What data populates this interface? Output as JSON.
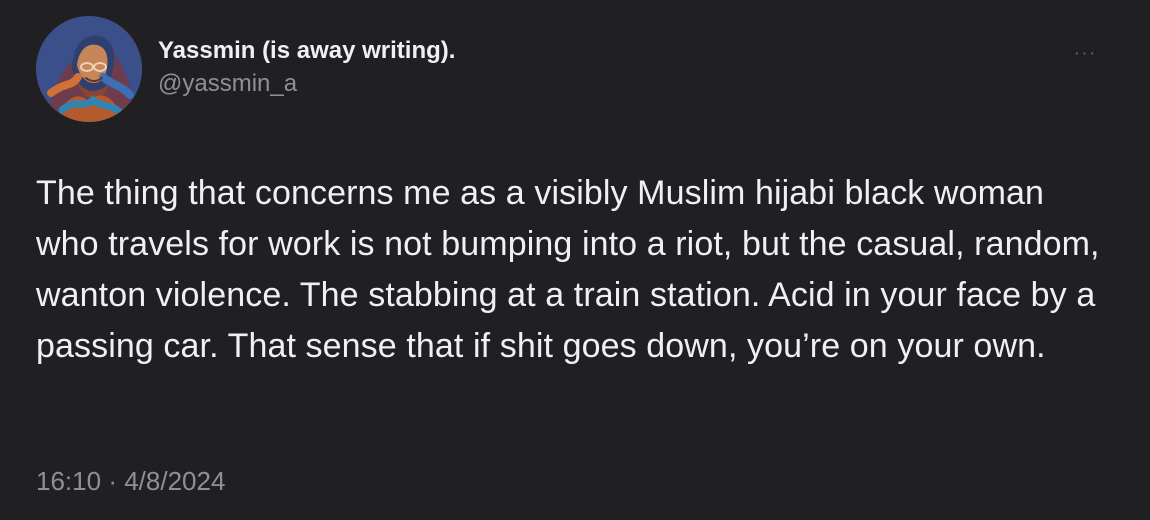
{
  "tweet": {
    "display_name": "Yassmin (is away writing).",
    "handle": "@yassmin_a",
    "text": "The thing that concerns me as a visibly Muslim hijabi black woman who travels for work is not bumping into a riot, but the casual, random,  wanton violence. The stabbing at a train station. Acid in your face by a passing car. That sense that if shit goes down, you’re on your own.",
    "time": "16:10",
    "separator": "·",
    "date": "4/8/2024"
  },
  "icons": {
    "avatar": "avatar-image",
    "more": "more-options-icon"
  },
  "colors": {
    "background": "#202023",
    "primary_text": "#eef0f2",
    "secondary_text": "#8d9197",
    "muted_icon": "#5c5f64"
  }
}
